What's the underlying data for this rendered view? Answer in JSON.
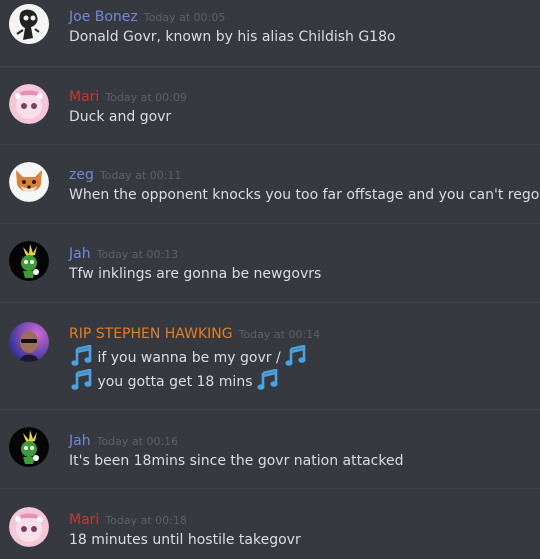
{
  "colors": {
    "background": "#36393f",
    "divider": "#40434a",
    "text": "#dcddde",
    "timestamp": "#5e6167",
    "name_blue": "#7289da",
    "name_red": "#c43a2f",
    "name_orange": "#e67e22",
    "note_blue": "#4aa3df"
  },
  "messages": [
    {
      "author": "Joe Bonez",
      "author_color": "#7289da",
      "timestamp": "Today at 00:05",
      "avatar_icon": "skeleton-avatar-icon",
      "lines": [
        "Donald Govr, known by his alias Childish G18o"
      ]
    },
    {
      "author": "Mari",
      "author_color": "#c43a2f",
      "timestamp": "Today at 00:09",
      "avatar_icon": "pink-anime-avatar-icon",
      "lines": [
        "Duck and govr"
      ]
    },
    {
      "author": "zeg",
      "author_color": "#7289da",
      "timestamp": "Today at 00:11",
      "avatar_icon": "fox-avatar-icon",
      "lines": [
        "When the opponent knocks you too far offstage and you can't regovr"
      ]
    },
    {
      "author": "Jah",
      "author_color": "#7289da",
      "timestamp": "Today at 00:13",
      "avatar_icon": "green-character-avatar-icon",
      "lines": [
        "Tfw inklings are gonna be newgovrs"
      ]
    },
    {
      "author": "RIP STEPHEN HAWKING",
      "author_color": "#e67e22",
      "timestamp": "Today at 00:14",
      "avatar_icon": "portrait-avatar-icon",
      "lines": [
        "if you wanna be my govr /",
        "you gotta get 18 mins"
      ],
      "emoji": "musical-note-icon"
    },
    {
      "author": "Jah",
      "author_color": "#7289da",
      "timestamp": "Today at 00:16",
      "avatar_icon": "green-character-avatar-icon",
      "lines": [
        "It's been 18mins since the govr nation attacked"
      ]
    },
    {
      "author": "Mari",
      "author_color": "#c43a2f",
      "timestamp": "Today at 00:18",
      "avatar_icon": "pink-anime-avatar-icon",
      "lines": [
        "18 minutes until hostile takegovr"
      ]
    }
  ]
}
